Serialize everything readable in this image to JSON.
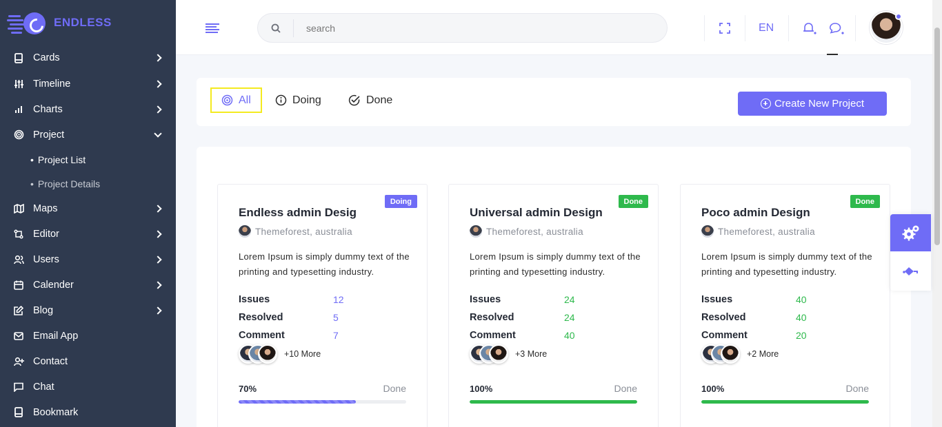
{
  "brand": {
    "name": "ENDLESS"
  },
  "sidebar": {
    "items": [
      {
        "label": "Cards",
        "icon": "cards-icon"
      },
      {
        "label": "Timeline",
        "icon": "timeline-icon"
      },
      {
        "label": "Charts",
        "icon": "bar-chart-icon"
      },
      {
        "label": "Project",
        "icon": "target-icon",
        "expanded": true
      },
      {
        "label": "Maps",
        "icon": "map-icon"
      },
      {
        "label": "Editor",
        "icon": "editor-icon"
      },
      {
        "label": "Users",
        "icon": "users-icon"
      },
      {
        "label": "Calender",
        "icon": "calendar-icon"
      },
      {
        "label": "Blog",
        "icon": "blog-icon"
      },
      {
        "label": "Email App",
        "icon": "mail-icon"
      },
      {
        "label": "Contact",
        "icon": "contact-icon"
      },
      {
        "label": "Chat",
        "icon": "chat-icon"
      },
      {
        "label": "Bookmark",
        "icon": "bookmark-icon"
      }
    ],
    "project_sub": [
      {
        "label": "Project List"
      },
      {
        "label": "Project Details"
      }
    ]
  },
  "header": {
    "search_placeholder": "search",
    "language": "EN"
  },
  "filters": {
    "tabs": [
      {
        "label": "All",
        "icon": "target-icon",
        "active": true
      },
      {
        "label": "Doing",
        "icon": "info-icon",
        "active": false
      },
      {
        "label": "Done",
        "icon": "check-circle-icon",
        "active": false
      }
    ],
    "create_button": "Create New Project"
  },
  "colors": {
    "primary": "#6f6cf6",
    "success": "#2eb94c",
    "sidebar": "#2f3a4f"
  },
  "projects": [
    {
      "title": "Endless admin Desig",
      "badge": "Doing",
      "badge_color": "#6f6cf6",
      "subtitle": "Themeforest, australia",
      "description": "Lorem Ipsum is simply dummy text of the printing and typesetting industry.",
      "stats": [
        {
          "label": "Issues",
          "value": "12"
        },
        {
          "label": "Resolved",
          "value": "5"
        },
        {
          "label": "Comment",
          "value": "7"
        }
      ],
      "value_color": "#6f6cf6",
      "more": "+10 More",
      "progress_label": "70%",
      "progress": 70,
      "progress_status": "Done"
    },
    {
      "title": "Universal admin Design",
      "badge": "Done",
      "badge_color": "#2eb94c",
      "subtitle": "Themeforest, australia",
      "description": "Lorem Ipsum is simply dummy text of the printing and typesetting industry.",
      "stats": [
        {
          "label": "Issues",
          "value": "24"
        },
        {
          "label": "Resolved",
          "value": "24"
        },
        {
          "label": "Comment",
          "value": "40"
        }
      ],
      "value_color": "#2eb94c",
      "more": "+3 More",
      "progress_label": "100%",
      "progress": 100,
      "progress_status": "Done"
    },
    {
      "title": "Poco admin Design",
      "badge": "Done",
      "badge_color": "#2eb94c",
      "subtitle": "Themeforest, australia",
      "description": "Lorem Ipsum is simply dummy text of the printing and typesetting industry.",
      "stats": [
        {
          "label": "Issues",
          "value": "40"
        },
        {
          "label": "Resolved",
          "value": "40"
        },
        {
          "label": "Comment",
          "value": "20"
        }
      ],
      "value_color": "#2eb94c",
      "more": "+2 More",
      "progress_label": "100%",
      "progress": 100,
      "progress_status": "Done"
    }
  ]
}
